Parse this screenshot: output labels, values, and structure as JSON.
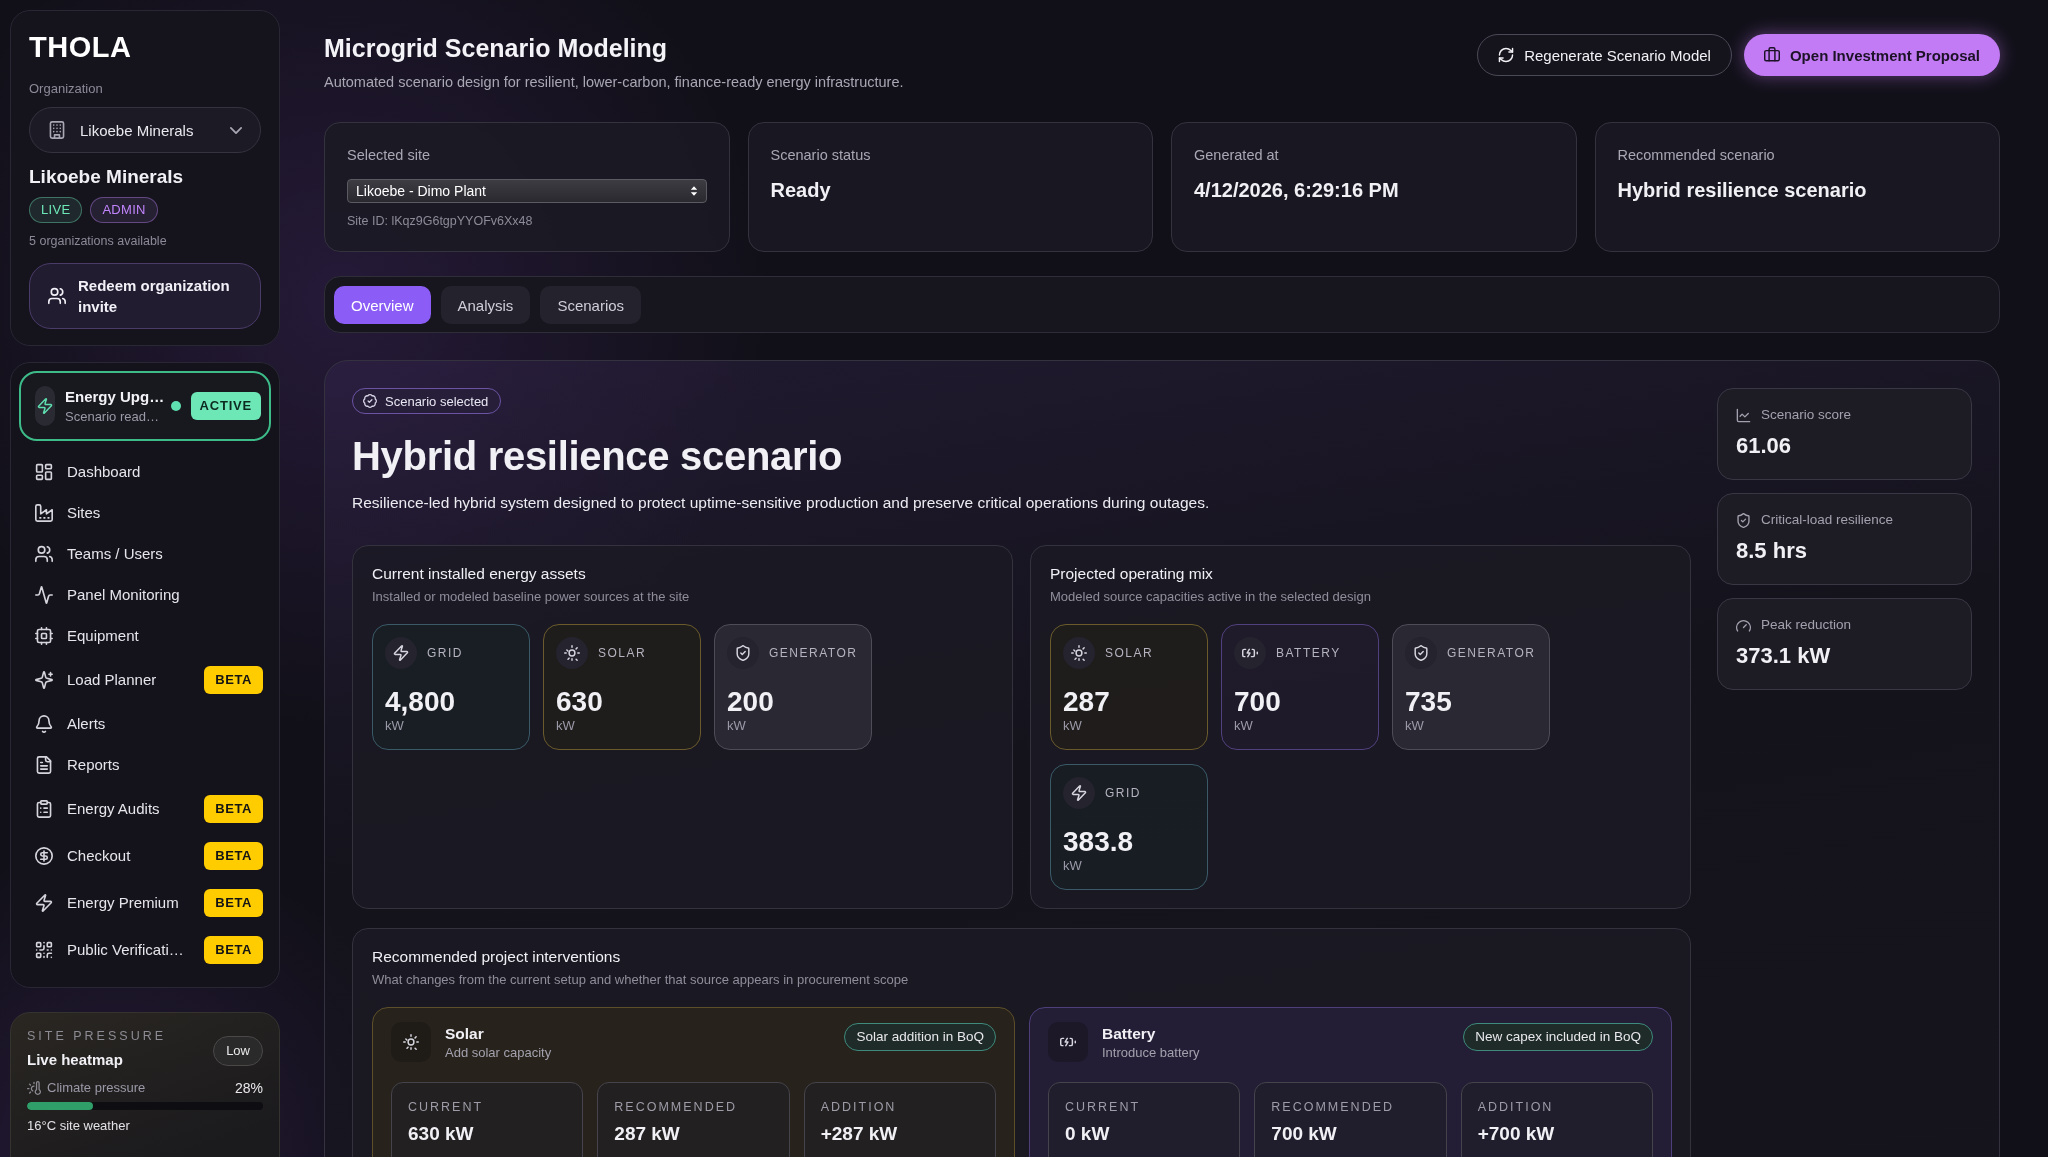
{
  "sidebar": {
    "logo": "THOLA",
    "organization": {
      "label": "Organization",
      "selector": "Likoebe Minerals",
      "name": "Likoebe Minerals",
      "badges": [
        {
          "label": "LIVE",
          "color": "#6ee7b7"
        },
        {
          "label": "ADMIN",
          "color": "#c084fc"
        }
      ],
      "count": "5 organizations available",
      "redeem_button": "Redeem organization invite"
    },
    "active_project": {
      "title": "Energy Upg…",
      "subtitle": "Scenario read…",
      "status": "ACTIVE"
    },
    "nav_items": [
      {
        "label": "Dashboard",
        "selected": false
      },
      {
        "label": "Sites",
        "selected": false
      },
      {
        "label": "Teams / Users",
        "selected": false
      },
      {
        "label": "Panel Monitoring",
        "selected": false
      },
      {
        "label": "Equipment",
        "selected": false
      },
      {
        "label": "Load Planner",
        "badge": "BETA",
        "selected": false
      },
      {
        "label": "Alerts",
        "selected": false
      },
      {
        "label": "Reports",
        "selected": false
      },
      {
        "label": "Energy Audits",
        "badge": "BETA",
        "selected": false
      },
      {
        "label": "Checkout",
        "badge": "BETA",
        "selected": false
      },
      {
        "label": "Energy Premium",
        "badge": "BETA",
        "selected": false
      },
      {
        "label": "Public Verificati…",
        "badge": "BETA",
        "selected": false
      }
    ],
    "site_pressure": {
      "eyebrow": "SITE PRESSURE",
      "title": "Live heatmap",
      "rating": "Low",
      "metrics": [
        {
          "label": "Climate pressure",
          "value": "28%",
          "level": 0.28,
          "note": "16°C site weather"
        }
      ]
    }
  },
  "header": {
    "title": "Microgrid Scenario Modeling",
    "subtitle": "Automated scenario design for resilient, lower-carbon, finance-ready energy infrastructure.",
    "buttons": [
      {
        "label": "Regenerate Scenario Model",
        "kind": "secondary"
      },
      {
        "label": "Open Investment Proposal",
        "kind": "primary"
      }
    ]
  },
  "summary_cards": [
    {
      "kind": "select",
      "label": "Selected site",
      "value": "Likoebe - Dimo Plant",
      "note": "Site ID: lKqz9G6tgpYYOFv6Xx48"
    },
    {
      "kind": "text",
      "label": "Scenario status",
      "value": "Ready"
    },
    {
      "kind": "text",
      "label": "Generated at",
      "value": "4/12/2026, 6:29:16 PM"
    },
    {
      "kind": "text",
      "label": "Recommended scenario",
      "value": "Hybrid resilience scenario"
    }
  ],
  "tabs": [
    {
      "label": "Overview",
      "selected": true
    },
    {
      "label": "Analysis",
      "selected": false
    },
    {
      "label": "Scenarios",
      "selected": false
    }
  ],
  "scenario": {
    "badge": "Scenario selected",
    "title": "Hybrid resilience scenario",
    "description": "Resilience-led hybrid system designed to protect uptime-sensitive production and preserve critical operations during outages.",
    "current_assets": {
      "title": "Current installed energy assets",
      "subtitle": "Installed or modeled baseline power sources at the site",
      "assets": [
        {
          "kind": "grid",
          "label": "GRID",
          "value": "4,800",
          "unit": "kW"
        },
        {
          "kind": "solar",
          "label": "SOLAR",
          "value": "630",
          "unit": "kW"
        },
        {
          "kind": "generator",
          "label": "GENERATOR",
          "value": "200",
          "unit": "kW"
        }
      ]
    },
    "projected_mix": {
      "title": "Projected operating mix",
      "subtitle": "Modeled source capacities active in the selected design",
      "assets": [
        {
          "kind": "solar",
          "label": "SOLAR",
          "value": "287",
          "unit": "kW"
        },
        {
          "kind": "battery",
          "label": "BATTERY",
          "value": "700",
          "unit": "kW"
        },
        {
          "kind": "generator",
          "label": "GENERATOR",
          "value": "735",
          "unit": "kW"
        },
        {
          "kind": "grid",
          "label": "GRID",
          "value": "383.8",
          "unit": "kW"
        }
      ]
    },
    "metrics": [
      {
        "label": "Scenario score",
        "value": "61.06"
      },
      {
        "label": "Critical-load resilience",
        "value": "8.5 hrs"
      },
      {
        "label": "Peak reduction",
        "value": "373.1 kW"
      }
    ],
    "interventions": {
      "title": "Recommended project interventions",
      "subtitle": "What changes from the current setup and whether that source appears in procurement scope",
      "items": [
        {
          "kind": "solar",
          "name": "Solar",
          "subtitle": "Add solar capacity",
          "tag": "Solar addition in BoQ",
          "figures": [
            {
              "label": "CURRENT",
              "value": "630 kW"
            },
            {
              "label": "RECOMMENDED",
              "value": "287 kW"
            },
            {
              "label": "ADDITION",
              "value": "+287 kW"
            }
          ]
        },
        {
          "kind": "battery",
          "name": "Battery",
          "subtitle": "Introduce battery",
          "tag": "New capex included in BoQ",
          "figures": [
            {
              "label": "CURRENT",
              "value": "0 kW"
            },
            {
              "label": "RECOMMENDED",
              "value": "700 kW"
            },
            {
              "label": "ADDITION",
              "value": "+700 kW"
            }
          ]
        }
      ]
    }
  }
}
